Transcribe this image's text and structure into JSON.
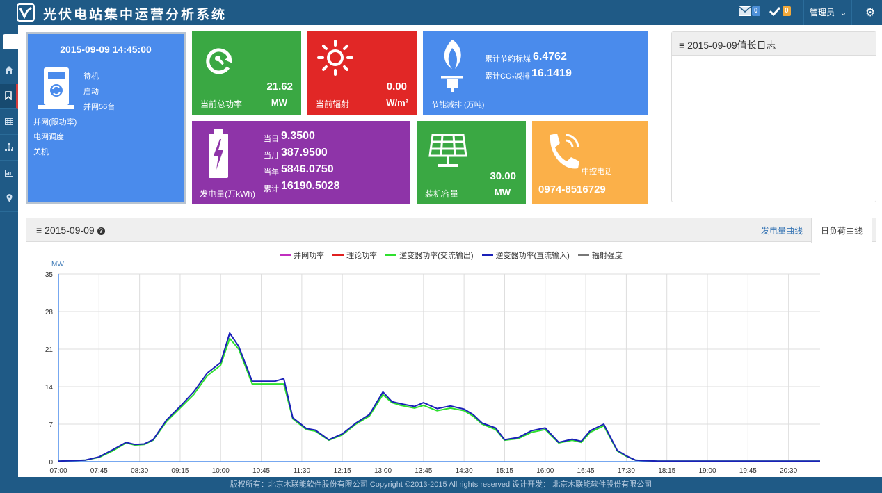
{
  "header": {
    "app_title": "光伏电站集中运营分析系统",
    "mail_count": "0",
    "task_count": "0",
    "user_label": "管理员"
  },
  "status": {
    "datetime": "2015-09-09 14:45:00",
    "legend_items": [
      "待机",
      "启动",
      "并网56台"
    ],
    "items": [
      "并网(限功率)",
      "电网调度",
      "关机"
    ]
  },
  "tiles": {
    "power": {
      "label": "当前总功率",
      "value": "21.62",
      "unit": "MW",
      "color": "#3aa843"
    },
    "radiation": {
      "label": "当前辐射",
      "value": "0.00",
      "unit": "W/m²",
      "color": "#e12726"
    },
    "saving": {
      "label": "节能减排 (万吨)",
      "coal_label": "累计节约标煤",
      "coal_value": "6.4762",
      "co2_label": "累计CO₂减排",
      "co2_value": "16.1419",
      "color": "#4a8bec"
    },
    "generation": {
      "label": "发电量(万kWh)",
      "color": "#8e34a8",
      "rows": [
        {
          "k": "当日",
          "v": "9.3500"
        },
        {
          "k": "当月",
          "v": "387.9500"
        },
        {
          "k": "当年",
          "v": "5846.0750"
        },
        {
          "k": "累计",
          "v": "16190.5028"
        }
      ]
    },
    "capacity": {
      "label": "装机容量",
      "value": "30.00",
      "unit": "MW",
      "color": "#3aa843"
    },
    "phone": {
      "label": "中控电话",
      "number": "0974-8516729",
      "color": "#fbb049"
    }
  },
  "log_panel": {
    "title": "2015-09-09值长日志"
  },
  "chart_panel": {
    "title": "2015-09-09",
    "tabs": [
      "发电量曲线",
      "日负荷曲线"
    ],
    "active_tab": 1
  },
  "chart_data": {
    "type": "line",
    "ylabel": "MW",
    "ylim": [
      0,
      35
    ],
    "yticks": [
      0,
      7,
      14,
      21,
      28,
      35
    ],
    "xticks": [
      "07:00",
      "07:45",
      "08:30",
      "09:15",
      "10:00",
      "10:45",
      "11:30",
      "12:15",
      "13:00",
      "13:45",
      "14:30",
      "15:15",
      "16:00",
      "16:45",
      "17:30",
      "18:15",
      "19:00",
      "19:45",
      "20:30"
    ],
    "x_start_minutes": 420,
    "x_end_minutes": 1265,
    "grid": true,
    "legend_position": "top-center",
    "series": [
      {
        "name": "并网功率",
        "color": "#c02fbf",
        "values": []
      },
      {
        "name": "理论功率",
        "color": "#e02020",
        "values": []
      },
      {
        "name": "逆变器功率(交流输出)",
        "color": "#2fe02f",
        "x": [
          "07:00",
          "07:30",
          "07:45",
          "08:00",
          "08:15",
          "08:25",
          "08:35",
          "08:45",
          "09:00",
          "09:15",
          "09:30",
          "09:45",
          "10:00",
          "10:10",
          "10:20",
          "10:35",
          "10:45",
          "11:00",
          "11:10",
          "11:20",
          "11:35",
          "11:45",
          "12:00",
          "12:15",
          "12:30",
          "12:45",
          "13:00",
          "13:10",
          "13:20",
          "13:35",
          "13:45",
          "14:00",
          "14:15",
          "14:30",
          "14:40",
          "14:50",
          "15:05",
          "15:15",
          "15:30",
          "15:45",
          "16:00",
          "16:15",
          "16:30",
          "16:40",
          "16:50",
          "17:05",
          "17:20",
          "17:30",
          "17:40",
          "17:50",
          "18:05",
          "18:15",
          "18:30",
          "19:00",
          "19:30",
          "20:00",
          "20:30",
          "21:05"
        ],
        "values": [
          0.1,
          0.3,
          0.8,
          2.0,
          3.5,
          3.1,
          3.2,
          4.0,
          7.5,
          10.0,
          12.5,
          16.0,
          18.0,
          23.0,
          21.0,
          14.5,
          14.5,
          14.5,
          14.5,
          8.0,
          6.0,
          5.7,
          4.0,
          5.0,
          7.0,
          8.5,
          12.5,
          11.0,
          10.5,
          10.0,
          10.5,
          9.5,
          10.0,
          9.5,
          8.5,
          7.0,
          6.0,
          4.0,
          4.3,
          5.5,
          6.0,
          3.5,
          4.0,
          3.6,
          5.5,
          6.7,
          2.0,
          1.0,
          0.3,
          0.2,
          0.1,
          0.1,
          0.1,
          0.1,
          0.1,
          0.1,
          0.1,
          0.1
        ]
      },
      {
        "name": "逆变器功率(直流输入)",
        "color": "#1a20b8",
        "x": [
          "07:00",
          "07:30",
          "07:45",
          "08:00",
          "08:15",
          "08:25",
          "08:35",
          "08:45",
          "09:00",
          "09:15",
          "09:30",
          "09:45",
          "10:00",
          "10:10",
          "10:20",
          "10:35",
          "10:45",
          "11:00",
          "11:10",
          "11:20",
          "11:35",
          "11:45",
          "12:00",
          "12:15",
          "12:30",
          "12:45",
          "13:00",
          "13:10",
          "13:20",
          "13:35",
          "13:45",
          "14:00",
          "14:15",
          "14:30",
          "14:40",
          "14:50",
          "15:05",
          "15:15",
          "15:30",
          "15:45",
          "16:00",
          "16:15",
          "16:30",
          "16:40",
          "16:50",
          "17:05",
          "17:20",
          "17:30",
          "17:40",
          "17:50",
          "18:05",
          "18:15",
          "18:30",
          "19:00",
          "19:30",
          "20:00",
          "20:30",
          "21:05"
        ],
        "values": [
          0.1,
          0.3,
          0.9,
          2.2,
          3.6,
          3.2,
          3.3,
          4.1,
          7.8,
          10.3,
          13.0,
          16.5,
          18.5,
          24.0,
          21.5,
          15.0,
          15.0,
          15.0,
          15.5,
          8.2,
          6.2,
          5.9,
          4.1,
          5.2,
          7.2,
          8.8,
          13.0,
          11.2,
          10.8,
          10.3,
          11.0,
          9.9,
          10.4,
          9.8,
          8.8,
          7.2,
          6.3,
          4.1,
          4.5,
          5.8,
          6.3,
          3.6,
          4.2,
          3.8,
          5.8,
          7.0,
          2.1,
          1.1,
          0.3,
          0.2,
          0.1,
          0.1,
          0.1,
          0.1,
          0.1,
          0.1,
          0.1,
          0.1
        ]
      },
      {
        "name": "辐射强度",
        "color": "#777777",
        "values": []
      }
    ]
  },
  "footer": {
    "text": "版权所有：北京木联能软件股份有限公司 Copyright ©2013-2015 All rights reserved 设计开发： 北京木联能软件股份有限公司"
  }
}
